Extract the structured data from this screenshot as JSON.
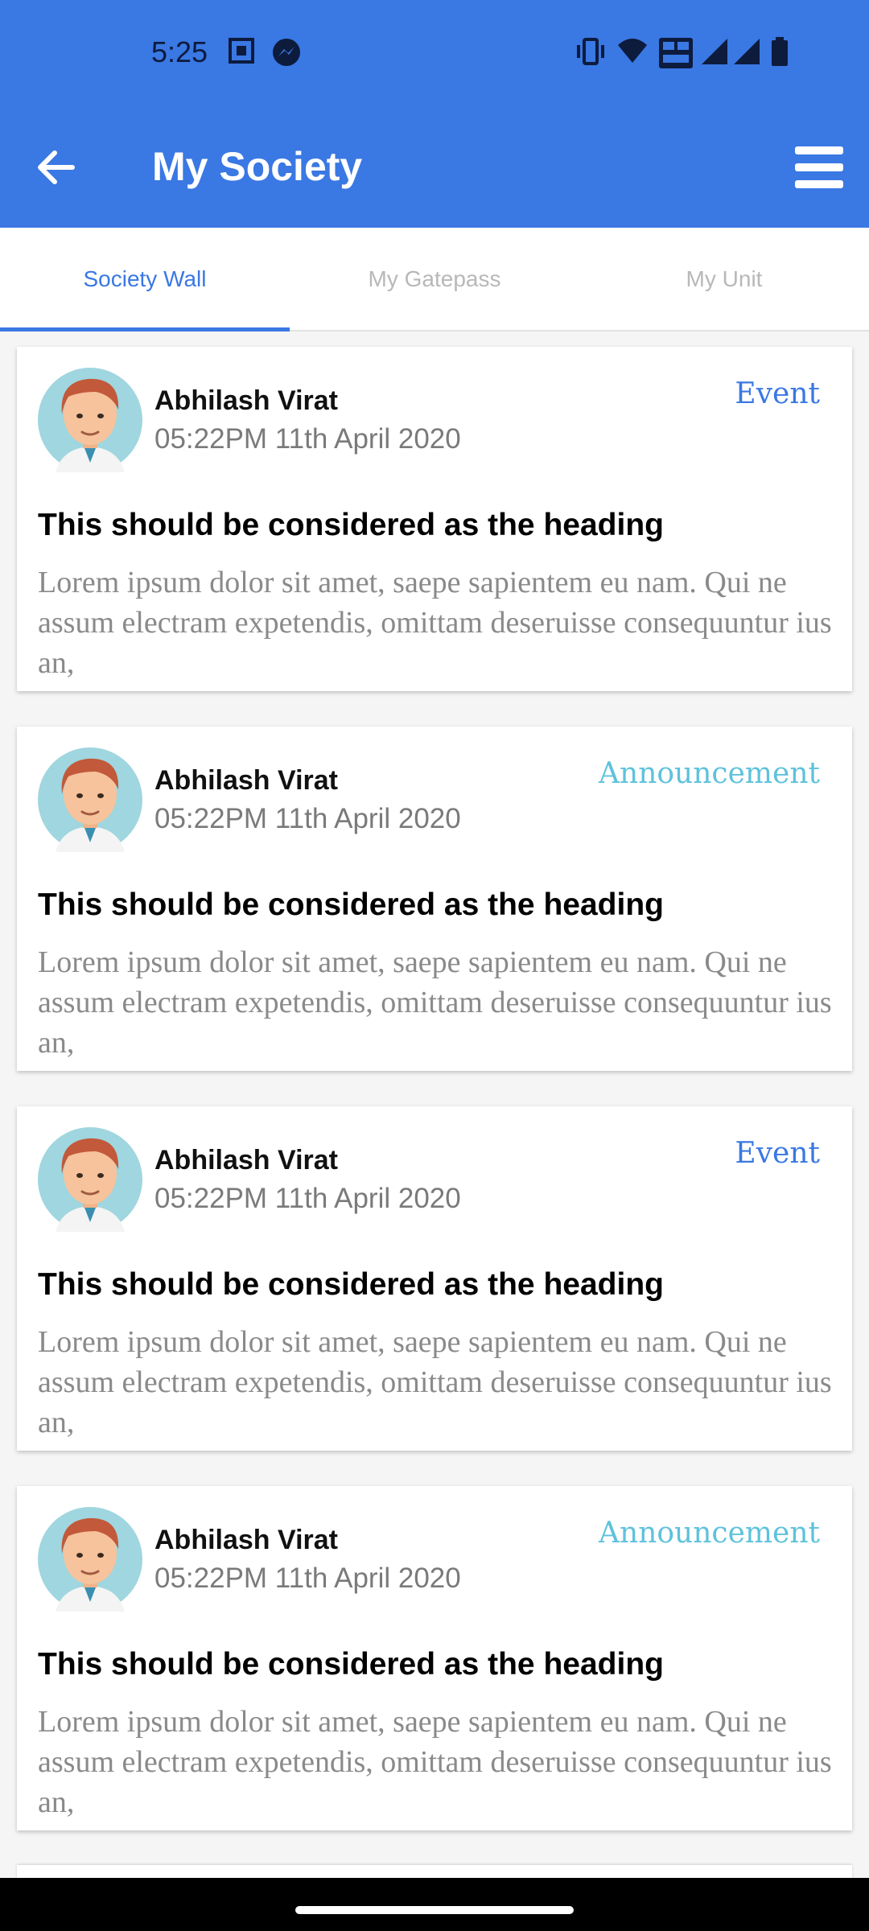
{
  "status_bar": {
    "time": "5:25"
  },
  "app_bar": {
    "title": "My Society"
  },
  "tabs": [
    {
      "label": "Society Wall",
      "active": true
    },
    {
      "label": "My Gatepass",
      "active": false
    },
    {
      "label": "My Unit",
      "active": false
    }
  ],
  "colors": {
    "primary": "#3a78e3",
    "event": "#3a78e3",
    "announcement": "#5ec2dc"
  },
  "posts": [
    {
      "author": "Abhilash Virat",
      "datetime": "05:22PM 11th April 2020",
      "tag": "Event",
      "heading": "This should be considered as the heading",
      "body": "Lorem ipsum dolor sit amet, saepe sapientem eu nam. Qui ne assum electram expetendis, omittam deseruisse consequuntur ius an,"
    },
    {
      "author": "Abhilash Virat",
      "datetime": "05:22PM 11th April 2020",
      "tag": "Announcement",
      "heading": "This should be considered as the heading",
      "body": "Lorem ipsum dolor sit amet, saepe sapientem eu nam. Qui ne assum electram expetendis, omittam deseruisse consequuntur ius an,"
    },
    {
      "author": "Abhilash Virat",
      "datetime": "05:22PM 11th April 2020",
      "tag": "Event",
      "heading": "This should be considered as the heading",
      "body": "Lorem ipsum dolor sit amet, saepe sapientem eu nam. Qui ne assum electram expetendis, omittam deseruisse consequuntur ius an,"
    },
    {
      "author": "Abhilash Virat",
      "datetime": "05:22PM 11th April 2020",
      "tag": "Announcement",
      "heading": "This should be considered as the heading",
      "body": "Lorem ipsum dolor sit amet, saepe sapientem eu nam. Qui ne assum electram expetendis, omittam deseruisse consequuntur ius an,"
    }
  ]
}
